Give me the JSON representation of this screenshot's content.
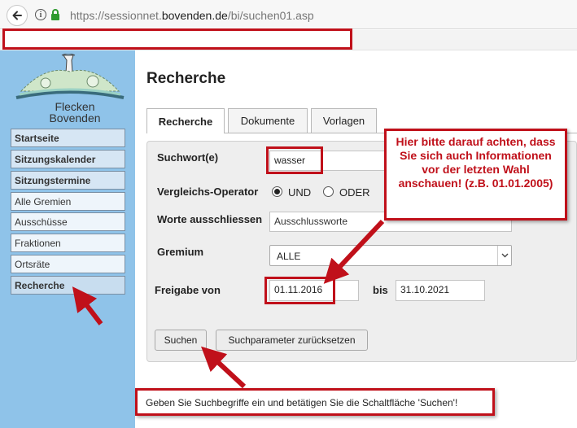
{
  "browser": {
    "url_prefix": "https://sessionnet.",
    "url_domain": "bovenden.de",
    "url_path": "/bi/suchen01.asp",
    "redacted_bar_text": ""
  },
  "sidebar": {
    "logo_line1": "Flecken",
    "logo_line2": "Bovenden",
    "items": [
      {
        "label": "Startseite",
        "kind": "main"
      },
      {
        "label": "Sitzungskalender",
        "kind": "main"
      },
      {
        "label": "Sitzungstermine",
        "kind": "main"
      },
      {
        "label": "Alle Gremien",
        "kind": "sub"
      },
      {
        "label": "Ausschüsse",
        "kind": "sub"
      },
      {
        "label": "Fraktionen",
        "kind": "sub"
      },
      {
        "label": "Ortsräte",
        "kind": "sub"
      },
      {
        "label": "Recherche",
        "kind": "active"
      }
    ]
  },
  "main": {
    "title": "Recherche",
    "tabs": [
      {
        "label": "Recherche",
        "active": true
      },
      {
        "label": "Dokumente",
        "active": false
      },
      {
        "label": "Vorlagen",
        "active": false
      }
    ]
  },
  "form": {
    "suchwort_label": "Suchwort(e)",
    "suchwort_value": "wasser",
    "operator_label": "Vergleichs-Operator",
    "operator_und": "UND",
    "operator_oder": "ODER",
    "operator_selected": "UND",
    "exclude_label": "Worte ausschliessen",
    "exclude_value": "Ausschlussworte",
    "gremium_label": "Gremium",
    "gremium_value": "ALLE",
    "freigabe_label": "Freigabe von",
    "freigabe_from": "01.11.2016",
    "bis_label": "bis",
    "freigabe_to": "31.10.2021",
    "search_button": "Suchen",
    "reset_button": "Suchparameter zurücksetzen"
  },
  "annotations": {
    "callout_text": "Hier bitte darauf achten, dass Sie sich auch Informationen vor der letzten Wahl anschauen! (z.B. 01.01.2005)",
    "hint_text": "Geben Sie Suchbegriffe ein und betätigen Sie die Schaltfläche 'Suchen'!",
    "accent_color": "#c0101a"
  },
  "colors": {
    "sidebar_bg": "#8fc3e9",
    "panel_bg": "#eeeeee"
  }
}
